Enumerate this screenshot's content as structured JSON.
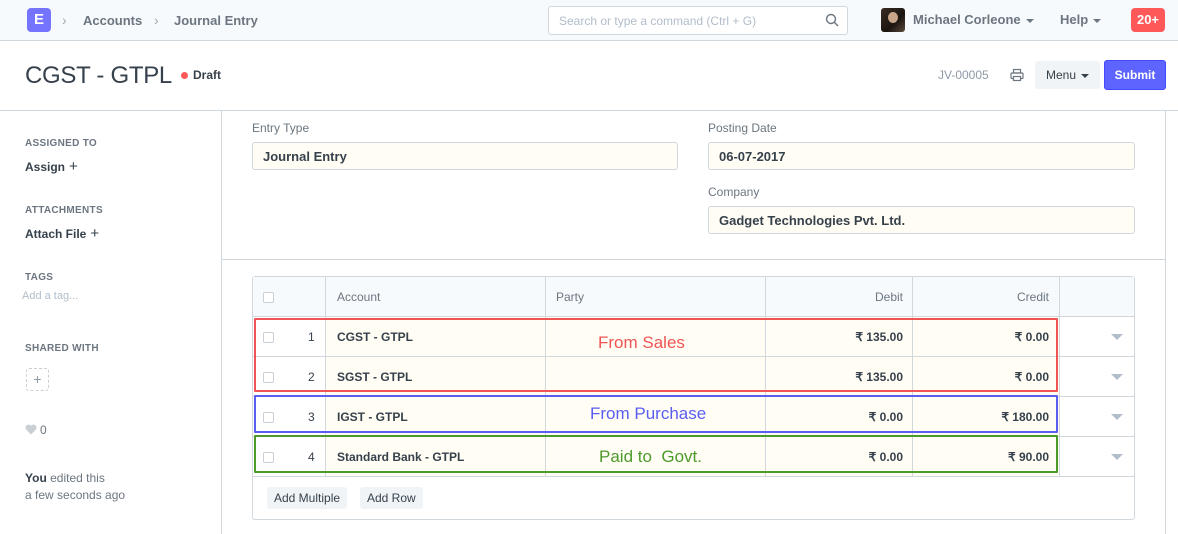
{
  "navbar": {
    "logo_letter": "E",
    "breadcrumbs": [
      "Accounts",
      "Journal Entry"
    ],
    "search_placeholder": "Search or type a command (Ctrl + G)",
    "user_name": "Michael Corleone",
    "help_label": "Help",
    "notification_count": "20+"
  },
  "page": {
    "title": "CGST - GTPL",
    "status": "Draft",
    "doc_name": "JV-00005",
    "menu_label": "Menu",
    "submit_label": "Submit"
  },
  "sidebar": {
    "assigned_to_label": "ASSIGNED TO",
    "assign_link": "Assign",
    "attachments_label": "ATTACHMENTS",
    "attach_link": "Attach File",
    "tags_label": "TAGS",
    "tag_placeholder": "Add a tag...",
    "shared_with_label": "SHARED WITH",
    "share_plus": "+",
    "like_count": "0",
    "edited_by": "You",
    "edited_action": "edited this",
    "edited_time": "a few seconds ago"
  },
  "form": {
    "entry_type_label": "Entry Type",
    "entry_type_value": "Journal Entry",
    "posting_date_label": "Posting Date",
    "posting_date_value": "06-07-2017",
    "company_label": "Company",
    "company_value": "Gadget Technologies Pvt. Ltd."
  },
  "grid": {
    "columns": [
      "Account",
      "Party",
      "Debit",
      "Credit"
    ],
    "rows": [
      {
        "idx": "1",
        "account": "CGST - GTPL",
        "party": "",
        "debit": "₹ 135.00",
        "credit": "₹ 0.00"
      },
      {
        "idx": "2",
        "account": "SGST - GTPL",
        "party": "",
        "debit": "₹ 135.00",
        "credit": "₹ 0.00"
      },
      {
        "idx": "3",
        "account": "IGST - GTPL",
        "party": "",
        "debit": "₹ 0.00",
        "credit": "₹ 180.00"
      },
      {
        "idx": "4",
        "account": "Standard Bank - GTPL",
        "party": "",
        "debit": "₹ 0.00",
        "credit": "₹ 90.00"
      }
    ],
    "add_multiple_label": "Add Multiple",
    "add_row_label": "Add Row"
  },
  "annotations": [
    {
      "text": "From Sales",
      "color": "#f05454"
    },
    {
      "text": "From Purchase",
      "color": "#5a5ef0"
    },
    {
      "text": "Paid to  Govt.",
      "color": "#4c9a2a"
    }
  ],
  "colors": {
    "brand": "#7574ff",
    "primary": "#5e64ff",
    "draft_indicator": "#ff5858",
    "notification": "#ff5858",
    "input_bg": "#fffdf4"
  }
}
